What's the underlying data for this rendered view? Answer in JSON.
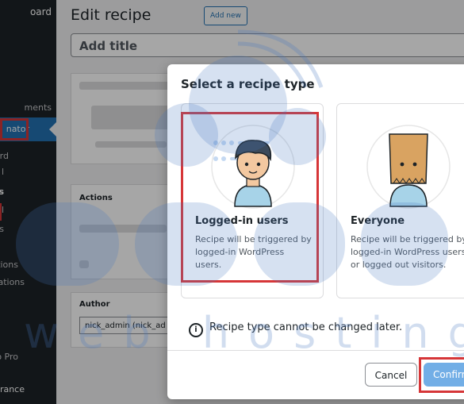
{
  "sidebar": {
    "items": [
      {
        "label": "oard"
      },
      {
        "label": "ments"
      },
      {
        "label": "nator"
      },
      {
        "label": "ard"
      },
      {
        "label": "l"
      },
      {
        "label": "s"
      },
      {
        "label": "l"
      },
      {
        "label": "s"
      },
      {
        "label": "tions"
      },
      {
        "label": "ations"
      },
      {
        "label": "o Pro"
      },
      {
        "label": "rance"
      }
    ]
  },
  "main": {
    "page_title": "Edit recipe",
    "add_new": "Add new",
    "title_placeholder": "Add title",
    "actions_title": "Actions",
    "author_title": "Author",
    "author_value": "nick_admin (nick_ad"
  },
  "modal": {
    "title": "Select a recipe type",
    "cards": [
      {
        "title": "Logged-in users",
        "desc": "Recipe will be triggered by logged-in WordPress users."
      },
      {
        "title": "Everyone",
        "desc": "Recipe will be triggered by logged-in WordPress users or logged out visitors."
      }
    ],
    "note": "Recipe type cannot be changed later.",
    "note_icon": "i",
    "cancel": "Cancel",
    "confirm": "Confirm"
  },
  "colors": {
    "accent": "#2271b1",
    "highlight_red": "#d63638",
    "confirm_bg": "#72aee6"
  }
}
